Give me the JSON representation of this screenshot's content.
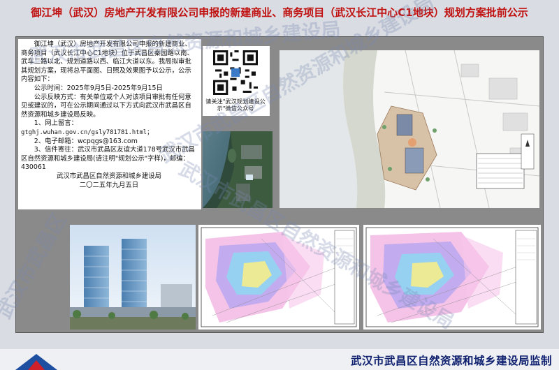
{
  "title": "御江坤（武汉）房地产开发有限公司申报的新建商业、商务项目（武汉长江中心C1地块）规划方案批前公示",
  "notice": {
    "intro": "御江坤（武汉）房地产开发有限公司申报的新建商业、商务项目（武汉长江中心C1地块）位于武昌区秦园路以南、武车二路以北、规划道路以西、临江大道以东。我局拟审批其规划方案，现将总平面图、日照及效果图予以公示，公示内容如下：",
    "period": "公示时间：2025年9月5日-2025年9月15日",
    "feedback": "公示反映方式：有关单位或个人对该项目审批有任何意见或建议的，可在公示期间通过以下方式向武汉市武昌区自然资源和城乡建设局反映。",
    "item1": "1、网上留言：",
    "url": "gtghj.wuhan.gov.cn/gsly781781.html；",
    "item2": "2、电子邮箱：wcpqgs@163.com",
    "item3": "3、信件寄往：武汉市武昌区友谊大道178号武汉市武昌区自然资源和城乡建设局(请注明\"规划公示\"字样)，邮编：430061",
    "sign_org": "武汉市武昌区自然资源和城乡建设局",
    "sign_date": "二〇二五年九月五日"
  },
  "qr_caption": "请关注\"武汉规划建设公示\"微信公众号",
  "footer": "武汉市武昌区自然资源和城乡建设局监制",
  "watermark": "武汉市武昌区自然资源和城乡建设局",
  "colors": {
    "title": "#c0100f",
    "footer": "#0d1f6e",
    "board": "#8a8a8a"
  }
}
